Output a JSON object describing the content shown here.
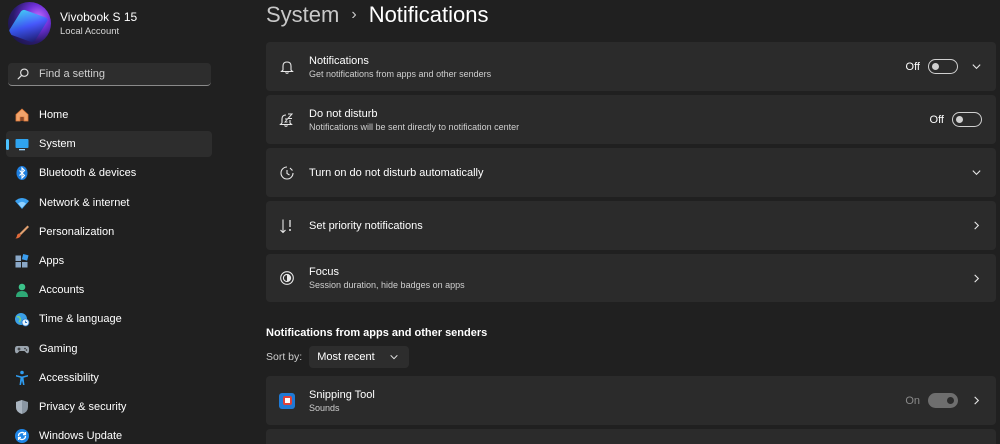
{
  "profile": {
    "name": "Vivobook S 15",
    "account": "Local Account"
  },
  "search": {
    "placeholder": "Find a setting"
  },
  "nav": [
    {
      "label": "Home",
      "icon": "home-icon"
    },
    {
      "label": "System",
      "icon": "system-icon",
      "active": true
    },
    {
      "label": "Bluetooth & devices",
      "icon": "bluetooth-icon"
    },
    {
      "label": "Network & internet",
      "icon": "wifi-icon"
    },
    {
      "label": "Personalization",
      "icon": "brush-icon"
    },
    {
      "label": "Apps",
      "icon": "apps-icon"
    },
    {
      "label": "Accounts",
      "icon": "accounts-icon"
    },
    {
      "label": "Time & language",
      "icon": "globe-clock-icon"
    },
    {
      "label": "Gaming",
      "icon": "gamepad-icon"
    },
    {
      "label": "Accessibility",
      "icon": "accessibility-icon"
    },
    {
      "label": "Privacy & security",
      "icon": "shield-icon"
    },
    {
      "label": "Windows Update",
      "icon": "update-icon"
    }
  ],
  "breadcrumb": {
    "parent": "System",
    "separator": "›",
    "current": "Notifications"
  },
  "cards": {
    "notifications": {
      "title": "Notifications",
      "subtitle": "Get notifications from apps and other senders",
      "state": "Off"
    },
    "dnd": {
      "title": "Do not disturb",
      "subtitle": "Notifications will be sent directly to notification center",
      "state": "Off"
    },
    "dnd_auto": {
      "title": "Turn on do not disturb automatically"
    },
    "priority": {
      "title": "Set priority notifications"
    },
    "focus": {
      "title": "Focus",
      "subtitle": "Session duration, hide badges on apps"
    }
  },
  "apps_section": {
    "title": "Notifications from apps and other senders",
    "sort_label": "Sort by:",
    "sort_value": "Most recent",
    "apps": [
      {
        "name": "Snipping Tool",
        "subtitle": "Sounds",
        "state": "On"
      }
    ]
  },
  "colors": {
    "accent": "#4cc2ff",
    "background": "#202020",
    "card": "#2b2b2b"
  }
}
